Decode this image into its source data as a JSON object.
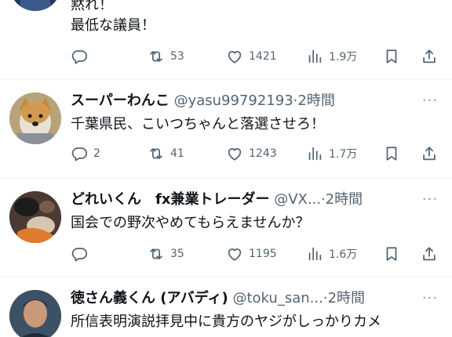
{
  "posts": [
    {
      "body": "黙れ！\n最低な議員！",
      "reply_count": "",
      "retweet_count": "53",
      "like_count": "1421",
      "view_count": "1.9万"
    },
    {
      "display_name": "スーパーわんこ",
      "handle": "@yasu99792193",
      "separator": "·",
      "time": "2時間",
      "body": "千葉県民、こいつちゃんと落選させろ！",
      "reply_count": "2",
      "retweet_count": "41",
      "like_count": "1243",
      "view_count": "1.7万"
    },
    {
      "display_name": "どれいくん　fx兼業トレーダー",
      "handle": "@VX...",
      "separator": "·",
      "time": "2時間",
      "body": "国会での野次やめてもらえませんか？",
      "reply_count": "",
      "retweet_count": "35",
      "like_count": "1195",
      "view_count": "1.6万"
    },
    {
      "display_name": "徳さん義くん (アバディ)",
      "handle": "@toku_san...",
      "separator": "·",
      "time": "2時間",
      "body": "所信表明演説拝見中に貴方のヤジがしっかりカメ"
    }
  ],
  "icons": {
    "more": "more-horizontal-icon",
    "reply": "reply-bubble-icon",
    "retweet": "retweet-icon",
    "like": "heart-icon",
    "views": "views-bar-chart-icon",
    "bookmark": "bookmark-icon",
    "share": "share-upload-icon"
  },
  "colors": {
    "text": "#0f1419",
    "secondary": "#536471",
    "divider": "#eff3f4",
    "background": "#ffffff"
  }
}
